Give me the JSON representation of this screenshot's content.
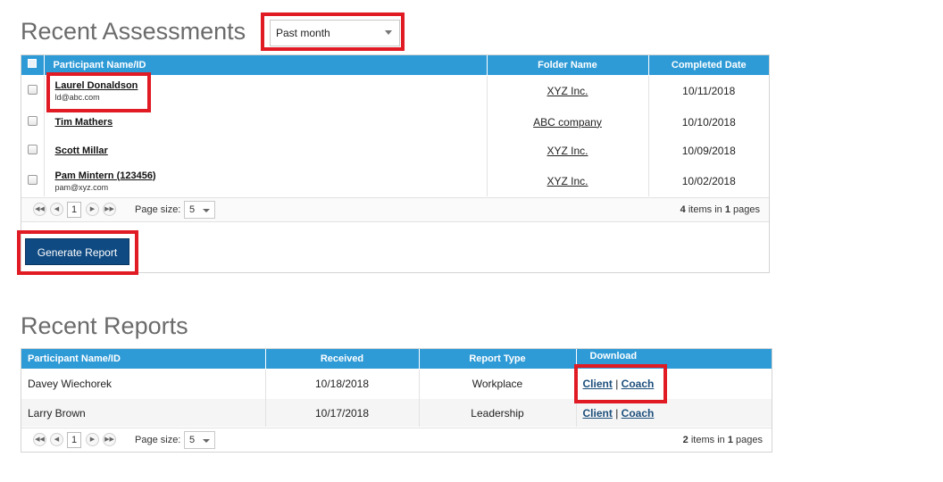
{
  "assessments": {
    "title": "Recent Assessments",
    "period_filter": "Past month",
    "columns": [
      "Participant Name/ID",
      "Folder Name",
      "Completed Date"
    ],
    "rows": [
      {
        "name": "Laurel Donaldson",
        "email": "ld@abc.com",
        "folder": "XYZ Inc.",
        "date": "10/11/2018"
      },
      {
        "name": "Tim Mathers",
        "email": "",
        "folder": "ABC company",
        "date": "10/10/2018"
      },
      {
        "name": "Scott Millar",
        "email": "",
        "folder": "XYZ Inc.",
        "date": "10/09/2018"
      },
      {
        "name": "Pam Mintern (123456)",
        "email": "pam@xyz.com",
        "folder": "XYZ Inc.",
        "date": "10/02/2018"
      }
    ],
    "pager": {
      "page": "1",
      "size_label": "Page size:",
      "size": "5",
      "items": "4",
      "items_in": "items in",
      "pages": "1",
      "pages_label": "pages"
    },
    "generate_label": "Generate Report"
  },
  "reports": {
    "title": "Recent Reports",
    "columns": [
      "Participant Name/ID",
      "Received",
      "Report Type",
      "Download"
    ],
    "rows": [
      {
        "name": "Davey Wiechorek",
        "received": "10/18/2018",
        "type": "Workplace",
        "client": "Client",
        "sep": "|",
        "coach": "Coach"
      },
      {
        "name": "Larry Brown",
        "received": "10/17/2018",
        "type": "Leadership",
        "client": "Client",
        "sep": "|",
        "coach": "Coach"
      }
    ],
    "pager": {
      "page": "1",
      "size_label": "Page size:",
      "size": "5",
      "items": "2",
      "items_in": "items in",
      "pages": "1",
      "pages_label": "pages"
    }
  },
  "icons": {
    "first": "first-page-icon",
    "prev": "prev-page-icon",
    "next": "next-page-icon",
    "last": "last-page-icon"
  },
  "colors": {
    "header_blue": "#2e9ad6",
    "button_navy": "#0f4a82",
    "highlight_red": "#e01b24"
  }
}
